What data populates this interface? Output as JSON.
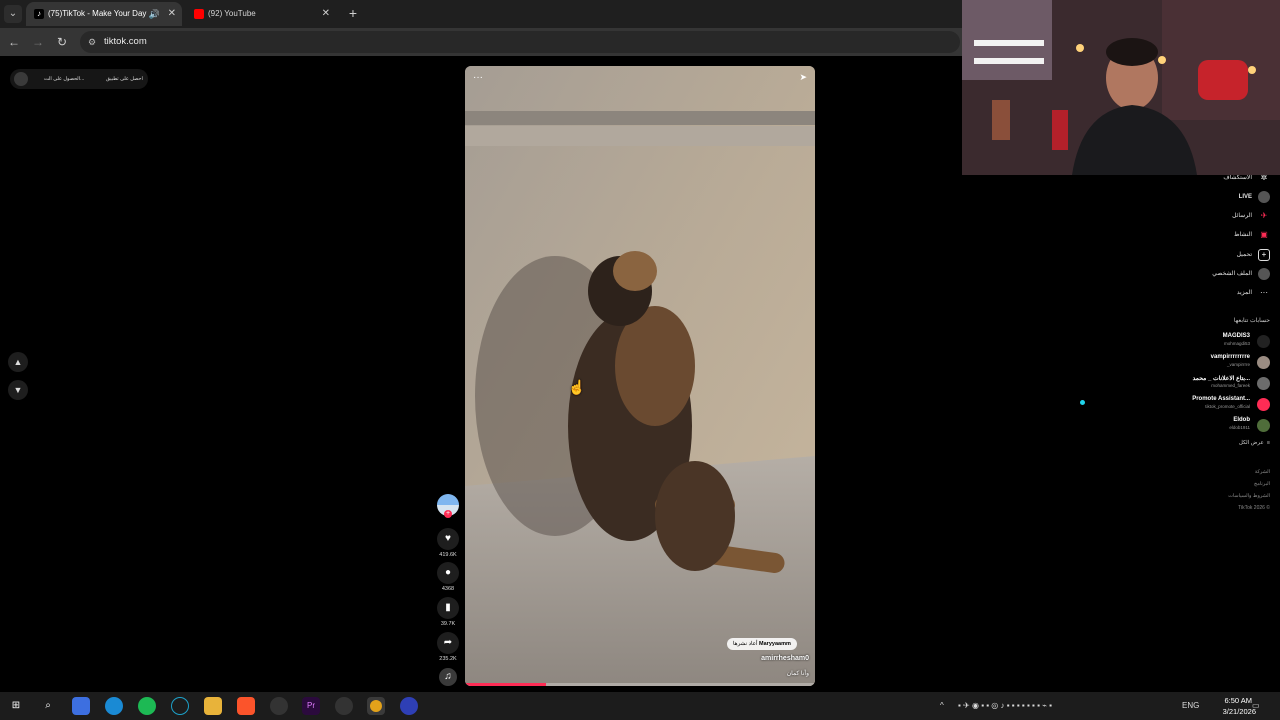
{
  "browser": {
    "tabs": [
      {
        "title": "(75)TikTok - Make Your Day",
        "active": true,
        "favicon": "tiktok-icon"
      },
      {
        "title": "(92) YouTube",
        "active": false,
        "favicon": "youtube-icon"
      }
    ],
    "url": "tiktok.com"
  },
  "top_pill": {
    "get_app": "احصل على تطبيق",
    "get_coins": "الحصول على الت..."
  },
  "video": {
    "remix_user": "Maryyaamm",
    "remix_label": "أعاد نشرها",
    "author": "amirrhesham0",
    "caption": "وأنا كمان",
    "progress": 0.23
  },
  "actions": {
    "likes": "419.6K",
    "comments": "4368",
    "saves": "39.7K",
    "shares": "235.2K"
  },
  "sidebar": {
    "nav": [
      {
        "label": "الاستكشاف",
        "icon": "compass-icon"
      },
      {
        "label": "LIVE",
        "icon": "live-icon"
      },
      {
        "label": "الرسائل",
        "icon": "messages-icon"
      },
      {
        "label": "النشاط",
        "icon": "activity-icon"
      },
      {
        "label": "تحميل",
        "icon": "upload-icon"
      },
      {
        "label": "الملف الشخصي",
        "icon": "profile-icon"
      },
      {
        "label": "المزيد",
        "icon": "more-icon"
      }
    ],
    "following_heading": "حسابات تتابعها",
    "accounts": [
      {
        "name": "MAGDIS3",
        "handle": "mohmagdi53",
        "live": false
      },
      {
        "name": "vampirrrrrrrre",
        "handle": "_vampirrrre",
        "live": false
      },
      {
        "name": "بتاع الاعلانات _ محمد...",
        "handle": "mohammed_fareek",
        "live": false
      },
      {
        "name": "Promote Assistant...",
        "handle": "tiktok_promote_official",
        "live": true
      },
      {
        "name": "Eldob",
        "handle": "eldob1911",
        "live": false
      }
    ],
    "see_all": "عرض الكل",
    "footer": [
      "الشركة",
      "البرنامج",
      "الشروط والسياسات",
      "TikTok 2026 ©"
    ]
  },
  "taskbar": {
    "language": "ENG",
    "time": "6:50 AM",
    "date": "3/21/2026"
  }
}
